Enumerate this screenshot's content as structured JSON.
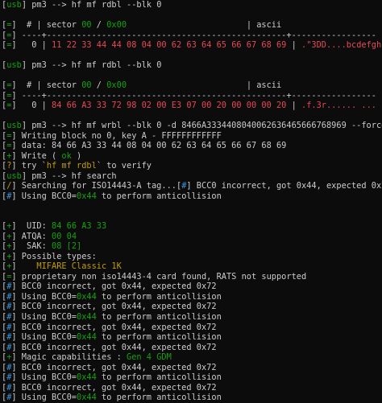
{
  "colors": {
    "background": "#0c0c0c",
    "default": "#cccccc",
    "green": "#13a10e",
    "yellow": "#c19c00",
    "red": "#e74856",
    "cyan": "#3a96dd"
  },
  "lines": [
    [
      {
        "t": "[",
        "c": "white"
      },
      {
        "t": "usb",
        "c": "green"
      },
      {
        "t": "] pm3 --> hf mf rdbl --blk 0",
        "c": "white"
      }
    ],
    [],
    [
      {
        "t": "[",
        "c": "white"
      },
      {
        "t": "=",
        "c": "green"
      },
      {
        "t": "]  # | sector ",
        "c": "white"
      },
      {
        "t": "00",
        "c": "green"
      },
      {
        "t": " / ",
        "c": "white"
      },
      {
        "t": "0x00",
        "c": "green"
      },
      {
        "t": "                        | ascii",
        "c": "white"
      }
    ],
    [
      {
        "t": "[",
        "c": "white"
      },
      {
        "t": "=",
        "c": "green"
      },
      {
        "t": "] ----+------------------------------------------------+-----------------",
        "c": "white"
      }
    ],
    [
      {
        "t": "[",
        "c": "white"
      },
      {
        "t": "=",
        "c": "green"
      },
      {
        "t": "]   0 | ",
        "c": "white"
      },
      {
        "t": "11 22 33 44 44 08 04 00 62 63 64 65 66 67 68 69",
        "c": "red"
      },
      {
        "t": " | ",
        "c": "white"
      },
      {
        "t": ".\"3DD....bcdefghi",
        "c": "red"
      }
    ],
    [],
    [
      {
        "t": "[",
        "c": "white"
      },
      {
        "t": "usb",
        "c": "green"
      },
      {
        "t": "] pm3 --> hf mf rdbl --blk 0",
        "c": "white"
      }
    ],
    [],
    [
      {
        "t": "[",
        "c": "white"
      },
      {
        "t": "=",
        "c": "green"
      },
      {
        "t": "]  # | sector ",
        "c": "white"
      },
      {
        "t": "00",
        "c": "green"
      },
      {
        "t": " / ",
        "c": "white"
      },
      {
        "t": "0x00",
        "c": "green"
      },
      {
        "t": "                        | ascii",
        "c": "white"
      }
    ],
    [
      {
        "t": "[",
        "c": "white"
      },
      {
        "t": "=",
        "c": "green"
      },
      {
        "t": "] ----+------------------------------------------------+-----------------",
        "c": "white"
      }
    ],
    [
      {
        "t": "[",
        "c": "white"
      },
      {
        "t": "=",
        "c": "green"
      },
      {
        "t": "]   0 | ",
        "c": "white"
      },
      {
        "t": "84 66 A3 33 72 98 02 00 E3 07 00 20 00 00 00 20",
        "c": "red"
      },
      {
        "t": " | ",
        "c": "white"
      },
      {
        "t": ".f.3r...... ... ",
        "c": "red"
      }
    ],
    [],
    [
      {
        "t": "[",
        "c": "white"
      },
      {
        "t": "usb",
        "c": "green"
      },
      {
        "t": "] pm3 --> hf mf wrbl --blk 0 -d 8466A3334408040062636465666768969 --force",
        "c": "white"
      }
    ],
    [
      {
        "t": "[",
        "c": "white"
      },
      {
        "t": "=",
        "c": "green"
      },
      {
        "t": "] Writing block no 0, key A - FFFFFFFFFFFF",
        "c": "white"
      }
    ],
    [
      {
        "t": "[",
        "c": "white"
      },
      {
        "t": "=",
        "c": "green"
      },
      {
        "t": "] data: 84 66 A3 33 44 08 04 00 62 63 64 65 66 67 68 69",
        "c": "white"
      }
    ],
    [
      {
        "t": "[",
        "c": "white"
      },
      {
        "t": "+",
        "c": "green"
      },
      {
        "t": "] Write ( ",
        "c": "white"
      },
      {
        "t": "ok",
        "c": "green"
      },
      {
        "t": " )",
        "c": "white"
      }
    ],
    [
      {
        "t": "[",
        "c": "white"
      },
      {
        "t": "?",
        "c": "yellow"
      },
      {
        "t": "] try `",
        "c": "white"
      },
      {
        "t": "hf mf rdbl",
        "c": "yellow"
      },
      {
        "t": "` to verify",
        "c": "white"
      }
    ],
    [
      {
        "t": "[",
        "c": "white"
      },
      {
        "t": "usb",
        "c": "green"
      },
      {
        "t": "] pm3 --> hf search",
        "c": "white"
      }
    ],
    [
      {
        "t": "[",
        "c": "white"
      },
      {
        "t": "/",
        "c": "yellow"
      },
      {
        "t": "] Searching for ISO14443-A tag...[",
        "c": "white"
      },
      {
        "t": "#",
        "c": "cyan"
      },
      {
        "t": "] BCC0 incorrect, got 0x44, expected 0x72",
        "c": "white"
      }
    ],
    [
      {
        "t": "[",
        "c": "white"
      },
      {
        "t": "#",
        "c": "cyan"
      },
      {
        "t": "] Using BCC0=",
        "c": "white"
      },
      {
        "t": "0x44",
        "c": "green"
      },
      {
        "t": " to perform anticollision",
        "c": "white"
      }
    ],
    [],
    [],
    [
      {
        "t": "[",
        "c": "white"
      },
      {
        "t": "+",
        "c": "green"
      },
      {
        "t": "]  UID: ",
        "c": "white"
      },
      {
        "t": "84 66 A3 33",
        "c": "green"
      }
    ],
    [
      {
        "t": "[",
        "c": "white"
      },
      {
        "t": "+",
        "c": "green"
      },
      {
        "t": "] ATQA: ",
        "c": "white"
      },
      {
        "t": "00 04",
        "c": "green"
      }
    ],
    [
      {
        "t": "[",
        "c": "white"
      },
      {
        "t": "+",
        "c": "green"
      },
      {
        "t": "]  SAK: ",
        "c": "white"
      },
      {
        "t": "08 [2]",
        "c": "green"
      }
    ],
    [
      {
        "t": "[",
        "c": "white"
      },
      {
        "t": "+",
        "c": "green"
      },
      {
        "t": "] Possible types:",
        "c": "white"
      }
    ],
    [
      {
        "t": "[",
        "c": "white"
      },
      {
        "t": "+",
        "c": "green"
      },
      {
        "t": "]    ",
        "c": "white"
      },
      {
        "t": "MIFARE Classic 1K",
        "c": "yellow"
      }
    ],
    [
      {
        "t": "[",
        "c": "white"
      },
      {
        "t": "=",
        "c": "green"
      },
      {
        "t": "] proprietary non iso14443-4 card found, RATS not supported",
        "c": "white"
      }
    ],
    [
      {
        "t": "[",
        "c": "white"
      },
      {
        "t": "#",
        "c": "cyan"
      },
      {
        "t": "] BCC0 incorrect, got 0x44, expected 0x72",
        "c": "white"
      }
    ],
    [
      {
        "t": "[",
        "c": "white"
      },
      {
        "t": "#",
        "c": "cyan"
      },
      {
        "t": "] Using BCC0=",
        "c": "white"
      },
      {
        "t": "0x44",
        "c": "green"
      },
      {
        "t": " to perform anticollision",
        "c": "white"
      }
    ],
    [
      {
        "t": "[",
        "c": "white"
      },
      {
        "t": "#",
        "c": "cyan"
      },
      {
        "t": "] BCC0 incorrect, got 0x44, expected 0x72",
        "c": "white"
      }
    ],
    [
      {
        "t": "[",
        "c": "white"
      },
      {
        "t": "#",
        "c": "cyan"
      },
      {
        "t": "] Using BCC0=",
        "c": "white"
      },
      {
        "t": "0x44",
        "c": "green"
      },
      {
        "t": " to perform anticollision",
        "c": "white"
      }
    ],
    [
      {
        "t": "[",
        "c": "white"
      },
      {
        "t": "#",
        "c": "cyan"
      },
      {
        "t": "] BCC0 incorrect, got 0x44, expected 0x72",
        "c": "white"
      }
    ],
    [
      {
        "t": "[",
        "c": "white"
      },
      {
        "t": "#",
        "c": "cyan"
      },
      {
        "t": "] Using BCC0=",
        "c": "white"
      },
      {
        "t": "0x44",
        "c": "green"
      },
      {
        "t": " to perform anticollision",
        "c": "white"
      }
    ],
    [
      {
        "t": "[",
        "c": "white"
      },
      {
        "t": "#",
        "c": "cyan"
      },
      {
        "t": "] BCC0 incorrect, got 0x44, expected 0x72",
        "c": "white"
      }
    ],
    [
      {
        "t": "[",
        "c": "white"
      },
      {
        "t": "+",
        "c": "green"
      },
      {
        "t": "] Magic capabilities : ",
        "c": "white"
      },
      {
        "t": "Gen 4 GDM",
        "c": "green"
      }
    ],
    [
      {
        "t": "[",
        "c": "white"
      },
      {
        "t": "#",
        "c": "cyan"
      },
      {
        "t": "] BCC0 incorrect, got 0x44, expected 0x72",
        "c": "white"
      }
    ],
    [
      {
        "t": "[",
        "c": "white"
      },
      {
        "t": "#",
        "c": "cyan"
      },
      {
        "t": "] Using BCC0=",
        "c": "white"
      },
      {
        "t": "0x44",
        "c": "green"
      },
      {
        "t": " to perform anticollision",
        "c": "white"
      }
    ],
    [
      {
        "t": "[",
        "c": "white"
      },
      {
        "t": "#",
        "c": "cyan"
      },
      {
        "t": "] BCC0 incorrect, got 0x44, expected 0x72",
        "c": "white"
      }
    ],
    [
      {
        "t": "[",
        "c": "white"
      },
      {
        "t": "#",
        "c": "cyan"
      },
      {
        "t": "] Using BCC0=",
        "c": "white"
      },
      {
        "t": "0x44",
        "c": "green"
      },
      {
        "t": " to perform anticollision",
        "c": "white"
      }
    ]
  ]
}
